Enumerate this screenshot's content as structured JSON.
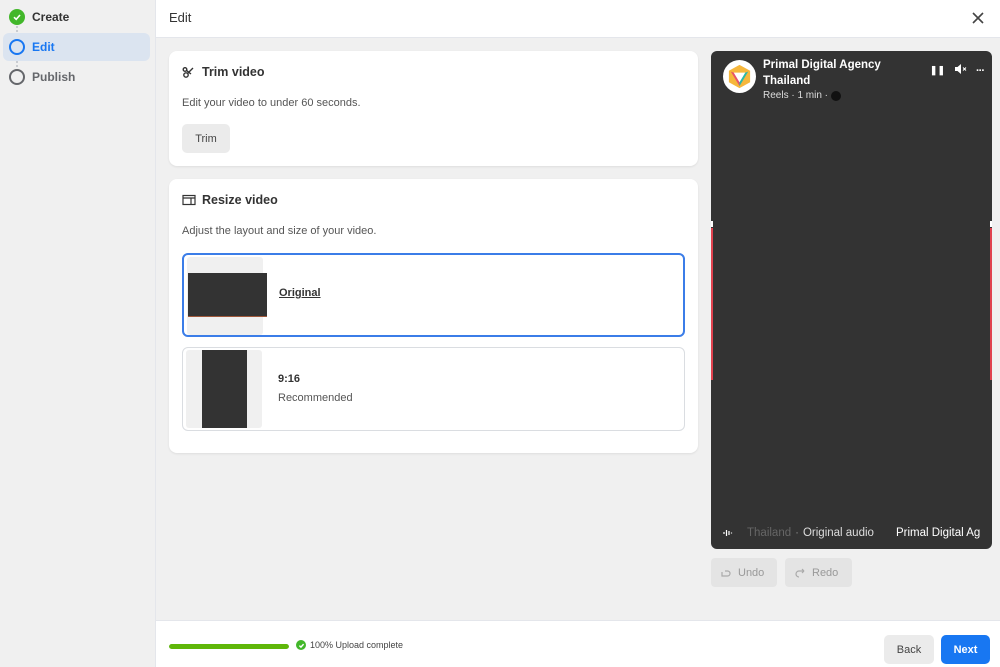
{
  "sidebar": {
    "steps": [
      {
        "label": "Create",
        "state": "complete"
      },
      {
        "label": "Edit",
        "state": "current"
      },
      {
        "label": "Publish",
        "state": "pending"
      }
    ]
  },
  "header": {
    "title": "Edit",
    "close_icon": "close-icon"
  },
  "trim": {
    "title": "Trim video",
    "icon": "scissors-icon",
    "description": "Edit your video to under 60 seconds.",
    "button_label": "Trim"
  },
  "resize": {
    "title": "Resize video",
    "icon": "resize-icon",
    "description": "Adjust the layout and size of your video.",
    "options": [
      {
        "label": "Original",
        "sublabel": "",
        "selected": true
      },
      {
        "label": "9:16",
        "sublabel": "Recommended",
        "selected": false
      }
    ]
  },
  "preview": {
    "page_name": "Primal Digital Agency Thailand",
    "meta": "Reels · 1 min ·",
    "audio_faded": "Thailand",
    "audio_separator": "·",
    "audio_label": "Original audio",
    "audio_scroll": "Primal Digital Ag",
    "controls": [
      "pause-icon",
      "mute-icon",
      "more-icon"
    ],
    "pause_glyph": "❚❚",
    "mute_glyph": "🔇",
    "more_glyph": "···"
  },
  "history": {
    "undo_label": "Undo",
    "redo_label": "Redo"
  },
  "footer": {
    "progress_percent": 100,
    "upload_status": "100% Upload complete",
    "back_label": "Back",
    "next_label": "Next"
  },
  "colors": {
    "accent": "#1877f2",
    "success": "#42b72a",
    "progress": "#5fb709",
    "selected_border": "#3b7de8"
  }
}
